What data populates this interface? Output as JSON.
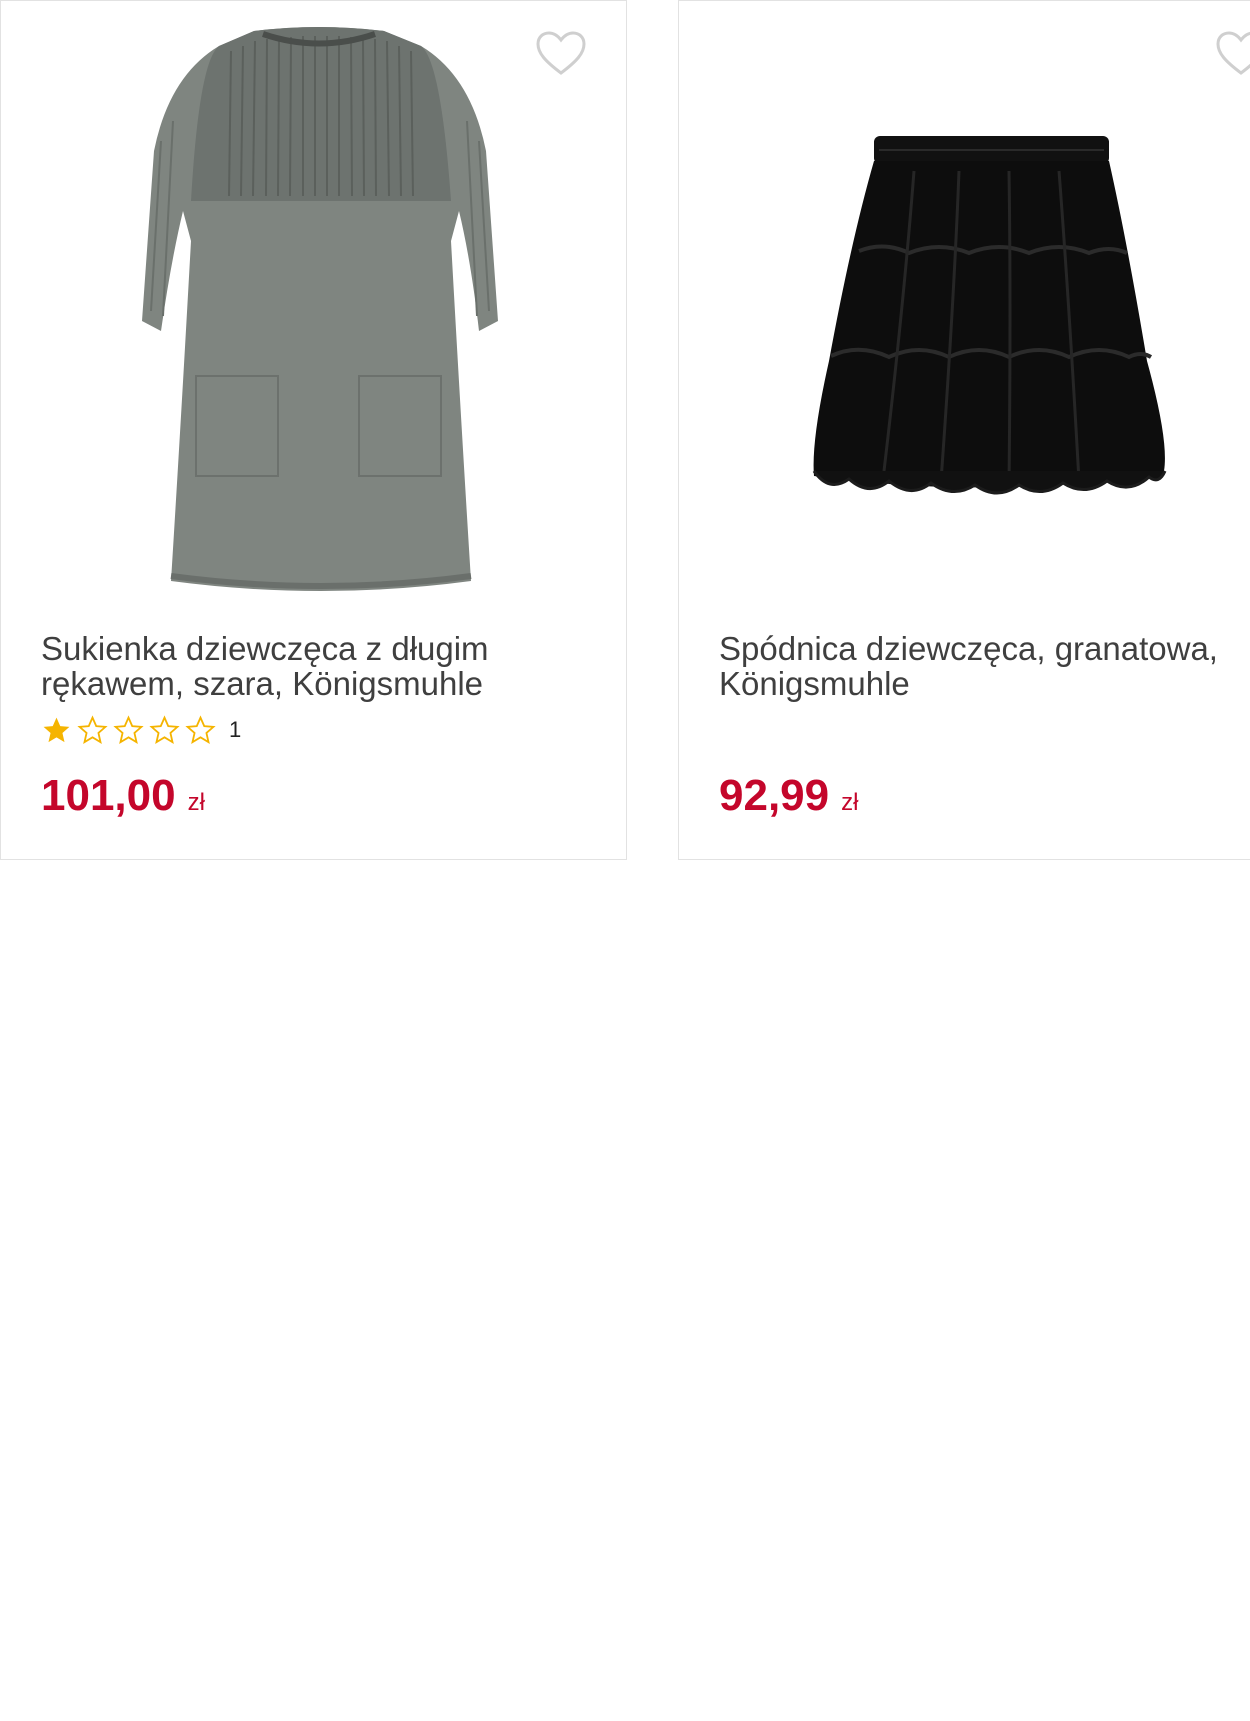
{
  "colors": {
    "price": "#c4062b",
    "star_filled": "#f5b400",
    "star_empty_outline": "#f5b400",
    "title_text": "#3f3f3f",
    "border": "#e2e2e2"
  },
  "products": [
    {
      "title": "Sukienka dziewczęca z długim rękawem, szara, Königsmuhle",
      "image_icon": "grey-knit-dress-image",
      "rating": {
        "stars": 1,
        "max": 5,
        "count": "1"
      },
      "price": "101,00",
      "currency": "zł"
    },
    {
      "title": "Spódnica dziewczęca, granatowa, Königsmuhle",
      "image_icon": "black-tulle-skirt-image",
      "price": "92,99",
      "currency": "zł"
    }
  ]
}
